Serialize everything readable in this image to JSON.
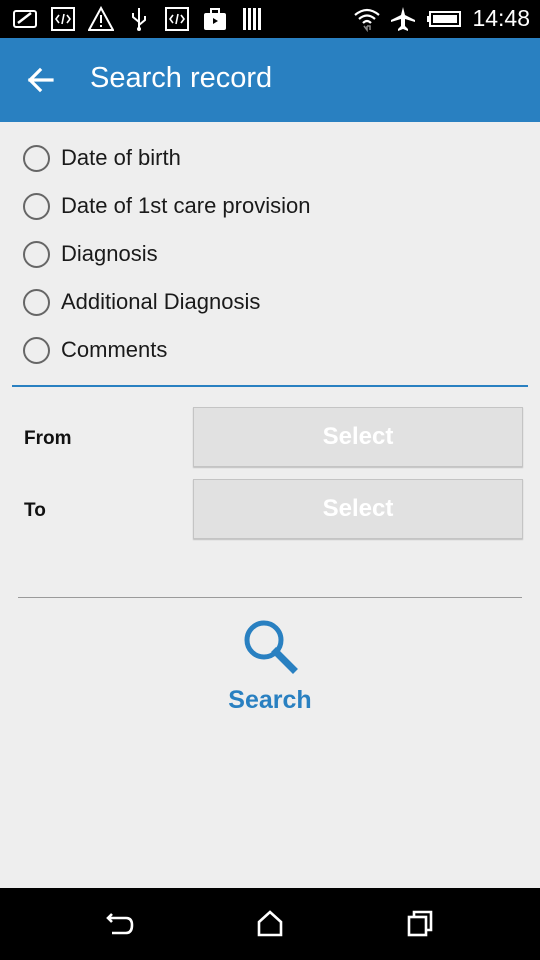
{
  "status_bar": {
    "time": "14:48",
    "icons": [
      "photo-edit-icon",
      "code-icon",
      "warning-icon",
      "usb-icon",
      "code-icon",
      "briefcase-icon",
      "barcode-icon",
      "wifi-icon",
      "airplane-icon",
      "battery-icon"
    ]
  },
  "app_bar": {
    "title": "Search record",
    "back_icon": "arrow-left-icon"
  },
  "radio_options": [
    {
      "label": "Date of birth",
      "selected": false
    },
    {
      "label": "Date of 1st care provision",
      "selected": false
    },
    {
      "label": "Diagnosis",
      "selected": false
    },
    {
      "label": "Additional Diagnosis",
      "selected": false
    },
    {
      "label": "Comments",
      "selected": false
    }
  ],
  "range": {
    "from_label": "From",
    "to_label": "To",
    "from_button": "Select",
    "to_button": "Select"
  },
  "search": {
    "label": "Search",
    "icon": "search-icon"
  },
  "colors": {
    "accent": "#2980c1",
    "background": "#eeeeee",
    "button_bg": "#e1e1e1"
  },
  "nav_bar": {
    "icons": [
      "back-icon",
      "home-icon",
      "recent-apps-icon"
    ]
  }
}
